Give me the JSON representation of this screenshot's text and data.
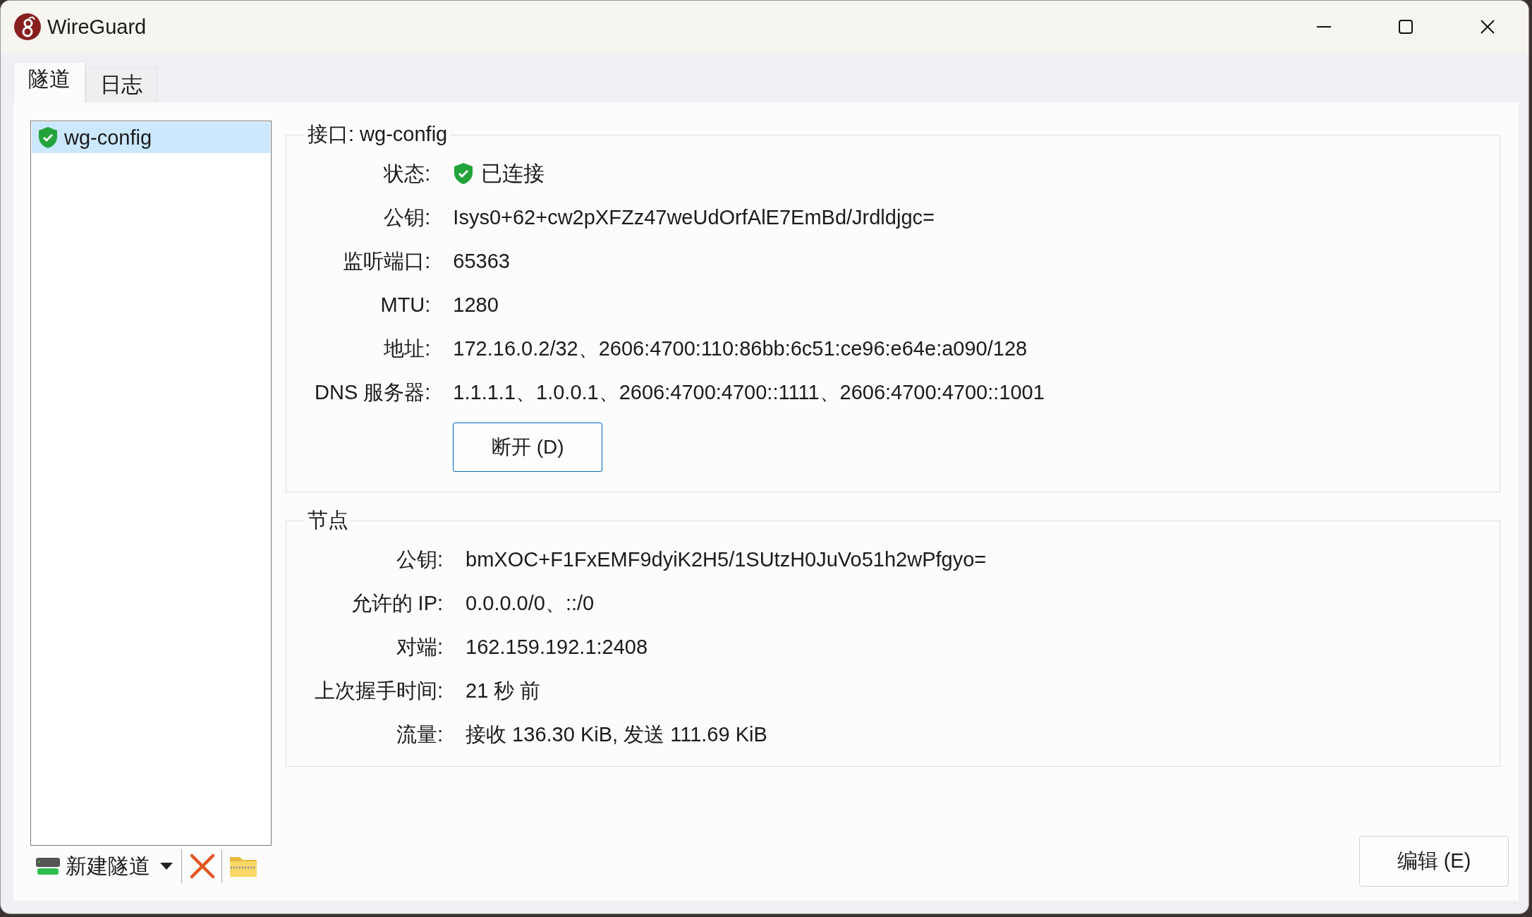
{
  "window": {
    "title": "WireGuard"
  },
  "tabs": [
    {
      "label": "隧道",
      "selected": true
    },
    {
      "label": "日志",
      "selected": false
    }
  ],
  "tunnels": [
    {
      "name": "wg-config",
      "selected": true,
      "connected": true
    }
  ],
  "toolbar": {
    "new_tunnel": "新建隧道"
  },
  "interface": {
    "title": "接口: wg-config",
    "status": {
      "label": "状态:",
      "value": "已连接",
      "connected": true
    },
    "fields": [
      {
        "label": "公钥:",
        "value": "Isys0+62+cw2pXFZz47weUdOrfAlE7EmBd/Jrdldjgc="
      },
      {
        "label": "监听端口:",
        "value": "65363"
      },
      {
        "label": "MTU:",
        "value": "1280"
      },
      {
        "label": "地址:",
        "value": "172.16.0.2/32、2606:4700:110:86bb:6c51:ce96:e64e:a090/128"
      },
      {
        "label": "DNS 服务器:",
        "value": "1.1.1.1、1.0.0.1、2606:4700:4700::1111、2606:4700:4700::1001"
      }
    ],
    "button": "断开 (D)"
  },
  "peer": {
    "title": "节点",
    "fields": [
      {
        "label": "公钥:",
        "value": "bmXOC+F1FxEMF9dyiK2H5/1SUtzH0JuVo51h2wPfgyo="
      },
      {
        "label": "允许的 IP:",
        "value": "0.0.0.0/0、::/0"
      },
      {
        "label": "对端:",
        "value": "162.159.192.1:2408"
      },
      {
        "label": "上次握手时间:",
        "value": "21 秒 前"
      },
      {
        "label": "流量:",
        "value": "接收 136.30 KiB, 发送 111.69 KiB"
      }
    ]
  },
  "edit_button": "编辑 (E)"
}
